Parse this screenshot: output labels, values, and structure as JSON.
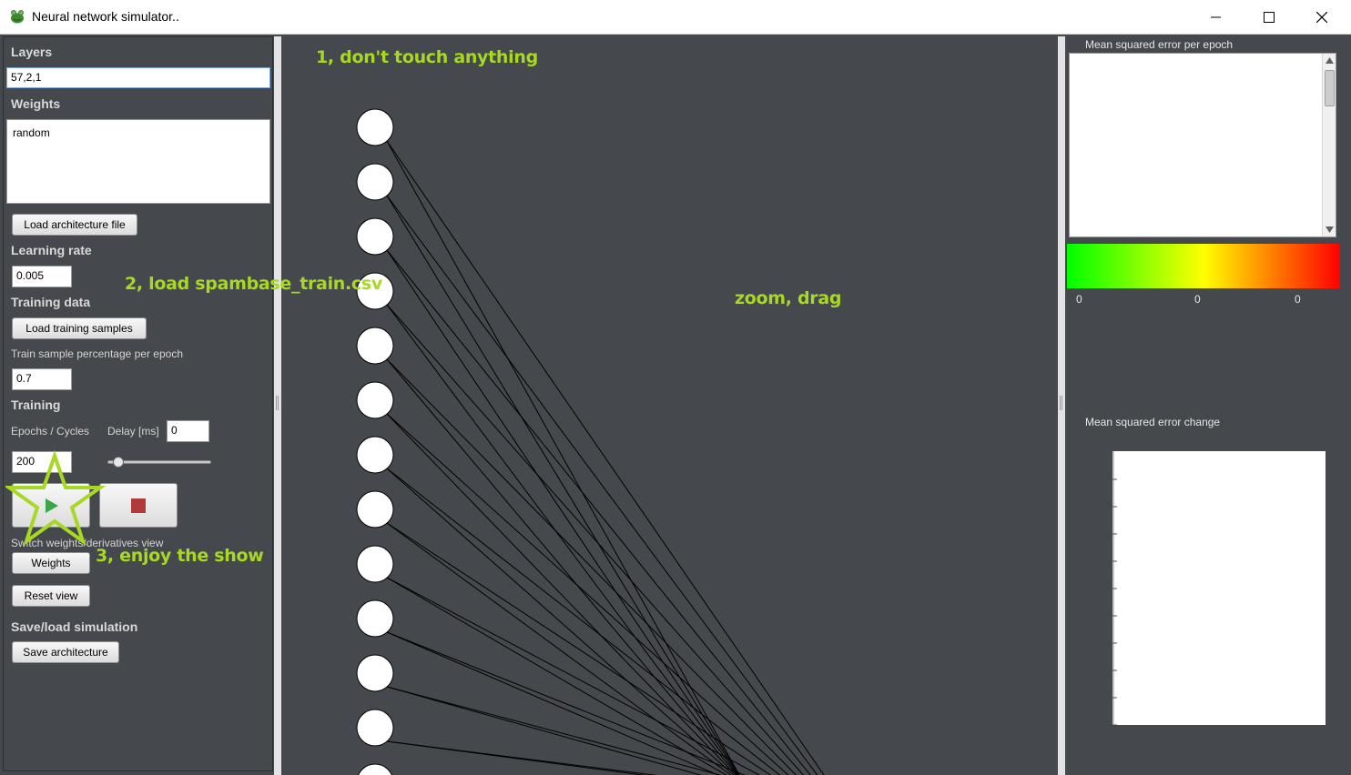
{
  "window": {
    "title": "Neural network simulator..",
    "icon": "frog-icon"
  },
  "left_panel": {
    "layers_heading": "Layers",
    "layers_value": "57,2,1",
    "weights_heading": "Weights",
    "weights_value": "random",
    "load_architecture_label": "Load architecture file",
    "learning_rate_heading": "Learning rate",
    "learning_rate_value": "0.005",
    "training_data_heading": "Training data",
    "load_training_label": "Load training samples",
    "train_pct_label": "Train sample percentage per epoch",
    "train_pct_value": "0.7",
    "training_heading": "Training",
    "epochs_label": "Epochs / Cycles",
    "delay_label": "Delay [ms]",
    "delay_value": "0",
    "epochs_value": "200",
    "delay_slider_fraction": 0.02,
    "switch_view_label": "Switch weights/derivatives view",
    "weights_button_label": "Weights",
    "reset_view_label": "Reset view",
    "save_load_heading": "Save/load simulation",
    "save_architecture_label": "Save architecture"
  },
  "annotations": {
    "step1": "1, don't touch anything",
    "step2": "2, load spambase_train.csv",
    "step3": "3, enjoy the show",
    "hint": "zoom, drag"
  },
  "right_panel": {
    "mse_epoch_title": "Mean squared error per epoch",
    "gradient_labels": [
      "0",
      "0",
      "0"
    ],
    "mse_change_title": "Mean squared error change"
  },
  "colors": {
    "background": "#45484c",
    "annotation": "#a6d824",
    "stop": "#b03a3a",
    "play": "#3aa64a"
  }
}
